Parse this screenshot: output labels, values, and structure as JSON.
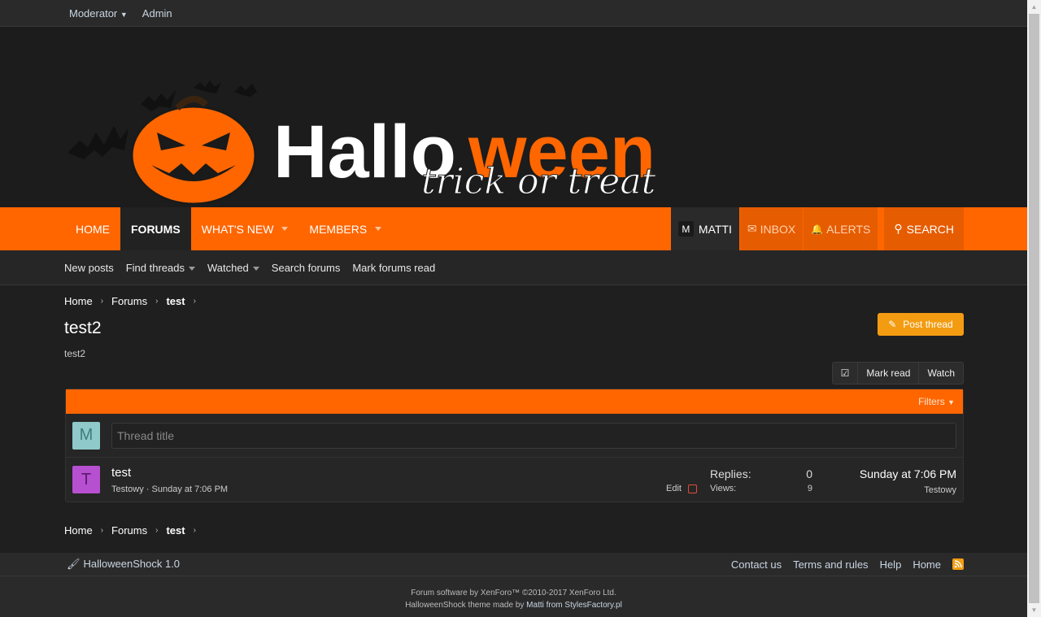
{
  "staffbar": {
    "moderator": "Moderator",
    "admin": "Admin"
  },
  "logo": {
    "word1": "Hallo",
    "word2": "ween",
    "tagline": "trick or treat"
  },
  "nav": {
    "items": [
      {
        "label": "HOME"
      },
      {
        "label": "FORUMS"
      },
      {
        "label": "WHAT'S NEW"
      },
      {
        "label": "MEMBERS"
      }
    ],
    "user_initial": "M",
    "user_name": "MATTI",
    "inbox": "INBOX",
    "alerts": "ALERTS",
    "search": "SEARCH"
  },
  "subnav": {
    "new_posts": "New posts",
    "find_threads": "Find threads",
    "watched": "Watched",
    "search_forums": "Search forums",
    "mark_read": "Mark forums read"
  },
  "breadcrumb": {
    "home": "Home",
    "forums": "Forums",
    "current": "test"
  },
  "page": {
    "title": "test2",
    "description": "test2",
    "post_thread": "Post thread"
  },
  "actions": {
    "mark_read": "Mark read",
    "watch": "Watch"
  },
  "block": {
    "filters": "Filters"
  },
  "quick_thread": {
    "avatar": "M",
    "placeholder": "Thread title"
  },
  "thread": {
    "avatar": "T",
    "title": "test",
    "author": "Testowy",
    "date": "Sunday at 7:06 PM",
    "edit": "Edit",
    "replies_label": "Replies:",
    "replies": "0",
    "views_label": "Views:",
    "views": "9",
    "last_date": "Sunday at 7:06 PM",
    "last_user": "Testowy"
  },
  "footer": {
    "style": "HalloweenShock 1.0",
    "contact": "Contact us",
    "terms": "Terms and rules",
    "help": "Help",
    "home": "Home",
    "software": "Forum software by XenForo™ ©2010-2017 XenForo Ltd.",
    "theme_prefix": "HalloweenShock theme made by",
    "theme_link": "Matti from StylesFactory.pl"
  },
  "colors": {
    "accent": "#ff6600",
    "button": "#f39c12",
    "avatar_m": "#8fc9c9",
    "avatar_t": "#b74fd1"
  }
}
